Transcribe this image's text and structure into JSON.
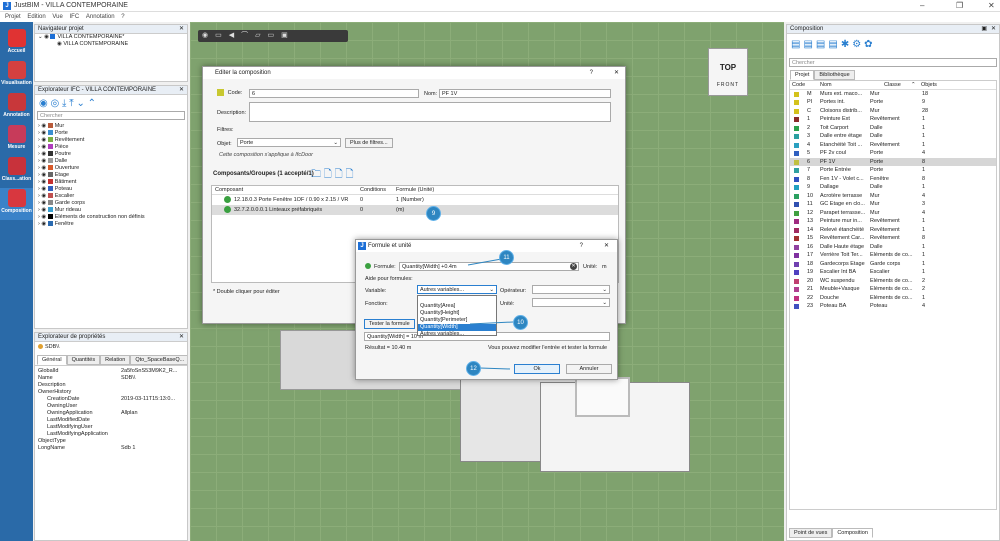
{
  "window": {
    "title": "JustBIM - VILLA CONTEMPORAINE",
    "minimize": "–",
    "maximize": "❐",
    "close": "✕"
  },
  "menu": [
    "Projet",
    "Edition",
    "Vue",
    "IFC",
    "Annotation",
    "?"
  ],
  "leftbar": [
    {
      "label": "Accueil",
      "color": "#e03333"
    },
    {
      "label": "Visualisation",
      "color": "#d44040"
    },
    {
      "label": "Annotation",
      "color": "#c8373a"
    },
    {
      "label": "Mesure",
      "color": "#c73b5a"
    },
    {
      "label": "Class...ation",
      "color": "#c8323b"
    },
    {
      "label": "Composition",
      "color": "#d8373f"
    }
  ],
  "navigator": {
    "title": "Navigateur projet",
    "close": "✕",
    "pin": "▣",
    "items": [
      "VILLA CONTEMPORAINE*",
      "VILLA CONTEMPORAINE"
    ]
  },
  "ifc_explorer": {
    "title": "Explorateur IFC - VILLA CONTEMPORAINE",
    "search_placeholder": "Chercher",
    "items": [
      {
        "label": "Mur",
        "color": "#b85a3a"
      },
      {
        "label": "Porte",
        "color": "#3a8fd1"
      },
      {
        "label": "Revêtement",
        "color": "#7ab042"
      },
      {
        "label": "Pièce",
        "color": "#b03dbd"
      },
      {
        "label": "Poutre",
        "color": "#333333"
      },
      {
        "label": "Dalle",
        "color": "#999999"
      },
      {
        "label": "Ouverture",
        "color": "#d85a2a"
      },
      {
        "label": "Etage",
        "color": "#666666"
      },
      {
        "label": "Bâtiment",
        "color": "#c53030"
      },
      {
        "label": "Poteau",
        "color": "#3060c0"
      },
      {
        "label": "Escalier",
        "color": "#c05050"
      },
      {
        "label": "Garde corps",
        "color": "#888888"
      },
      {
        "label": "Mur rideau",
        "color": "#3aa0d0"
      },
      {
        "label": "Eléments de construction non définis",
        "color": "#000000",
        "q": "?"
      },
      {
        "label": "Fenêtre",
        "color": "#2a6ab0"
      }
    ]
  },
  "props": {
    "title": "Explorateur de propriétés",
    "object": "SDB\\\\",
    "tabs": [
      "Général",
      "Quantités",
      "Relation",
      "Qto_SpaceBaseQ..."
    ],
    "rows": [
      [
        "GlobalId",
        "2a5foSnS53M9K2_R..."
      ],
      [
        "Name",
        "SDB\\\\"
      ],
      [
        "Description",
        ""
      ],
      [
        "OwnerHistory",
        ""
      ],
      [
        "CreationDate",
        "2019-03-11T15:13:0..."
      ],
      [
        "OwningUser",
        ""
      ],
      [
        "OwningApplication",
        "Allplan"
      ],
      [
        "LastModifiedDate",
        ""
      ],
      [
        "LastModifyingUser",
        ""
      ],
      [
        "LastModifyingApplication",
        ""
      ],
      [
        "ObjectType",
        ""
      ],
      [
        "LongName",
        "Sdb 1"
      ]
    ]
  },
  "viewcube": {
    "top": "TOP",
    "front": "FRONT"
  },
  "edit_dialog": {
    "title": "Editer la composition",
    "help": "?",
    "close": "✕",
    "code_label": "Code:",
    "code_value": "6",
    "name_label": "Nom:",
    "name_value": "PF 1V",
    "desc_label": "Description:",
    "filters_label": "Filtres:",
    "object_label": "Objet:",
    "object_value": "Porte",
    "more_filters": "Plus de filtres...",
    "applies": "Cette composition s'applique à IfcDoor",
    "components_title": "Composants/Groupes (1 accepté/1)",
    "col_component": "Composant",
    "col_conditions": "Conditions",
    "col_formula": "Formule (Unité)",
    "rows": [
      {
        "comp": "12.18.0.3 Porte Fenêtre 1OF / 0.90 x 2.15 / VR",
        "cond": "0",
        "formula": "1 (Number)"
      },
      {
        "comp": "32.7.2.0.0.0.1 Linteaux préfabriqués",
        "cond": "0",
        "formula": "(m)"
      }
    ],
    "hint": "* Double cliquer pour éditer"
  },
  "formula_dialog": {
    "title": "Formule et unité",
    "help": "?",
    "close": "✕",
    "formula_label": "Formule:",
    "formula_value": "Quantity[Width] +0.4m",
    "unit_label": "Unité:",
    "unit_value": "m",
    "aide": "Aide pour formules:",
    "variable_label": "Variable:",
    "variable_value": "Autres variables...",
    "operator_label": "Opérateur:",
    "function_label": "Fonction:",
    "unit2_label": "Unité:",
    "options": [
      "Quantity[Area]",
      "Quantity[Height]",
      "Quantity[Perimeter]",
      "Quantity[Width]",
      "Autres variables..."
    ],
    "selected_option": "Quantity[Width]",
    "test_button": "Tester la formule",
    "test_input": "Quantity[Width] = 10 m",
    "result": "Résultat = 10.40 m",
    "notice": "Vous pouvez modifier l'entrée et tester la formule",
    "ok": "Ok",
    "cancel": "Annuler"
  },
  "badges": [
    "9",
    "10",
    "11",
    "12"
  ],
  "composition": {
    "title": "Composition",
    "pin": "▣",
    "close": "✕",
    "search_placeholder": "Chercher",
    "tabs": [
      "Projet",
      "Bibliothèque"
    ],
    "cols": [
      "Code",
      "Nom",
      "Classe",
      "Objets"
    ],
    "bottom_tabs": [
      "Point de vues",
      "Composition"
    ],
    "rows": [
      {
        "color": "#d4c21c",
        "code": "M",
        "nom": "Murs ext. maco...",
        "classe": "Mur",
        "obj": "18"
      },
      {
        "color": "#d4c21c",
        "code": "PI",
        "nom": "Portes int.",
        "classe": "Porte",
        "obj": "9"
      },
      {
        "color": "#d4c21c",
        "code": "C",
        "nom": "Cloisons distrib...",
        "classe": "Mur",
        "obj": "28"
      },
      {
        "color": "#8a2a2a",
        "code": "1",
        "nom": "Peinture Ext",
        "classe": "Revêtement",
        "obj": "1"
      },
      {
        "color": "#2aa04a",
        "code": "2",
        "nom": "Toit Carport",
        "classe": "Dalle",
        "obj": "1"
      },
      {
        "color": "#2aa0a0",
        "code": "3",
        "nom": "Dalle entre étage",
        "classe": "Dalle",
        "obj": "1"
      },
      {
        "color": "#2aa0c0",
        "code": "4",
        "nom": "Etanchéité Toit ...",
        "classe": "Revêtement",
        "obj": "1"
      },
      {
        "color": "#3060c0",
        "code": "5",
        "nom": "PF 2v coul",
        "classe": "Porte",
        "obj": "4"
      },
      {
        "color": "#c0c040",
        "code": "6",
        "nom": "PF 1V",
        "classe": "Porte",
        "obj": "8",
        "sel": true
      },
      {
        "color": "#30a0a0",
        "code": "7",
        "nom": "Porte Entrée",
        "classe": "Porte",
        "obj": "1"
      },
      {
        "color": "#3050c0",
        "code": "8",
        "nom": "Fen 1V - Volet c...",
        "classe": "Fenêtre",
        "obj": "8"
      },
      {
        "color": "#20a0c0",
        "code": "9",
        "nom": "Dallage",
        "classe": "Dalle",
        "obj": "1"
      },
      {
        "color": "#2aa060",
        "code": "10",
        "nom": "Acrotère terrasse",
        "classe": "Mur",
        "obj": "4"
      },
      {
        "color": "#3050b0",
        "code": "11",
        "nom": "GC Etage en clo...",
        "classe": "Mur",
        "obj": "3"
      },
      {
        "color": "#40a040",
        "code": "12",
        "nom": "Parapet terrasse...",
        "classe": "Mur",
        "obj": "4"
      },
      {
        "color": "#a02a80",
        "code": "13",
        "nom": "Peinture mur in...",
        "classe": "Revêtement",
        "obj": "1"
      },
      {
        "color": "#a02a60",
        "code": "14",
        "nom": "Relevé étanchéité",
        "classe": "Revêtement",
        "obj": "1"
      },
      {
        "color": "#a03030",
        "code": "15",
        "nom": "Revêtement Car...",
        "classe": "Revêtement",
        "obj": "8"
      },
      {
        "color": "#9040a0",
        "code": "16",
        "nom": "Dalle Haute étage",
        "classe": "Dalle",
        "obj": "1"
      },
      {
        "color": "#8030a0",
        "code": "17",
        "nom": "Verrière Toit Ter...",
        "classe": "Eléments de co...",
        "obj": "1"
      },
      {
        "color": "#7040b0",
        "code": "18",
        "nom": "Gardecorps Etage",
        "classe": "Garde corps",
        "obj": "1"
      },
      {
        "color": "#5040c0",
        "code": "19",
        "nom": "Escalier Int BA",
        "classe": "Escalier",
        "obj": "1"
      },
      {
        "color": "#c04070",
        "code": "20",
        "nom": "WC suspendu",
        "classe": "Eléments de co...",
        "obj": "2"
      },
      {
        "color": "#b04090",
        "code": "21",
        "nom": "Meuble+Vasque",
        "classe": "Eléments de co...",
        "obj": "2"
      },
      {
        "color": "#c03080",
        "code": "22",
        "nom": "Douche",
        "classe": "Eléments de co...",
        "obj": "1"
      },
      {
        "color": "#4050c0",
        "code": "23",
        "nom": "Poteau BA",
        "classe": "Poteau",
        "obj": "4"
      }
    ]
  }
}
